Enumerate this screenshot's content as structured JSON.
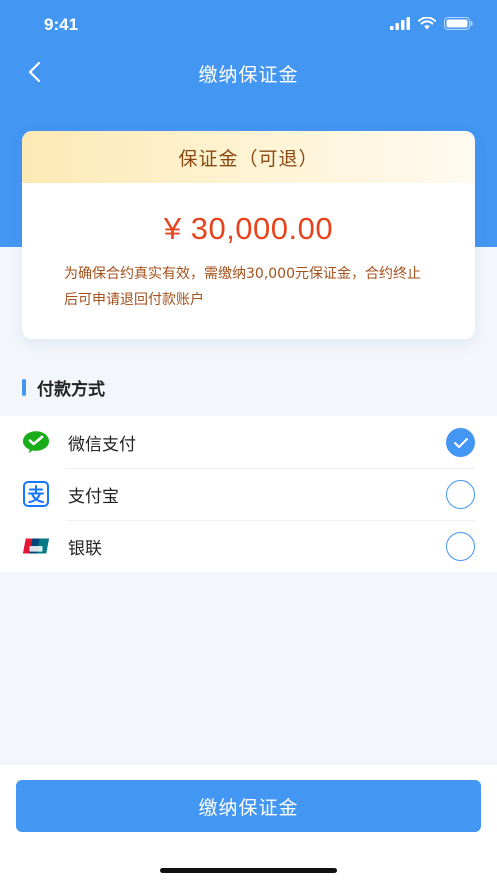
{
  "status_bar": {
    "time": "9:41"
  },
  "nav": {
    "title": "缴纳保证金"
  },
  "deposit_card": {
    "header": "保证金（可退）",
    "amount": "¥ 30,000.00",
    "notice": "为确保合约真实有效，需缴纳30,000元保证金，合约终止后可申请退回付款账户"
  },
  "payment": {
    "section_title": "付款方式",
    "methods": [
      {
        "label": "微信支付",
        "icon": "wechat-pay-icon",
        "checked": true
      },
      {
        "label": "支付宝",
        "icon": "alipay-icon",
        "checked": false
      },
      {
        "label": "银联",
        "icon": "unionpay-icon",
        "checked": false
      }
    ]
  },
  "submit": {
    "label": "缴纳保证金"
  },
  "colors": {
    "primary": "#4496f3",
    "amount": "#e8431f",
    "notice": "#a4511c",
    "card_head_text": "#8a4a14",
    "wechat": "#1aad19",
    "alipay": "#1677ff"
  }
}
